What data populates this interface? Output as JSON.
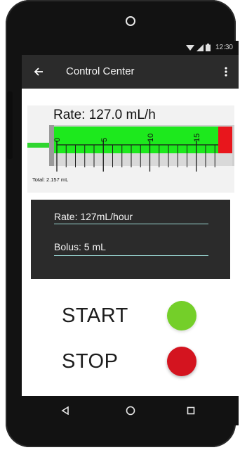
{
  "status_bar": {
    "time": "12:30",
    "icons": [
      "wifi-icon",
      "cellular-signal-icon",
      "battery-icon"
    ]
  },
  "app_bar": {
    "title": "Control Center",
    "back_icon": "arrow-left-icon",
    "menu_icon": "more-vert-icon"
  },
  "pump": {
    "rate_display": "Rate: 127.0 mL/h",
    "total_label": "Total: 2.157 mL",
    "scale_labels": [
      "0",
      "5",
      "10",
      "15"
    ],
    "colors": {
      "fill": "#1de91d",
      "alarm": "#e8161c",
      "plunger": "#2fd62f"
    }
  },
  "settings": {
    "rate_field": "Rate:  127mL/hour",
    "bolus_field": "Bolus:  5 mL"
  },
  "actions": {
    "start_label": "START",
    "stop_label": "STOP",
    "start_color": "#74cf29",
    "stop_color": "#d4141f"
  },
  "nav": {
    "back_icon": "nav-back-triangle-icon",
    "home_icon": "nav-home-circle-icon",
    "recents_icon": "nav-recents-square-icon"
  }
}
